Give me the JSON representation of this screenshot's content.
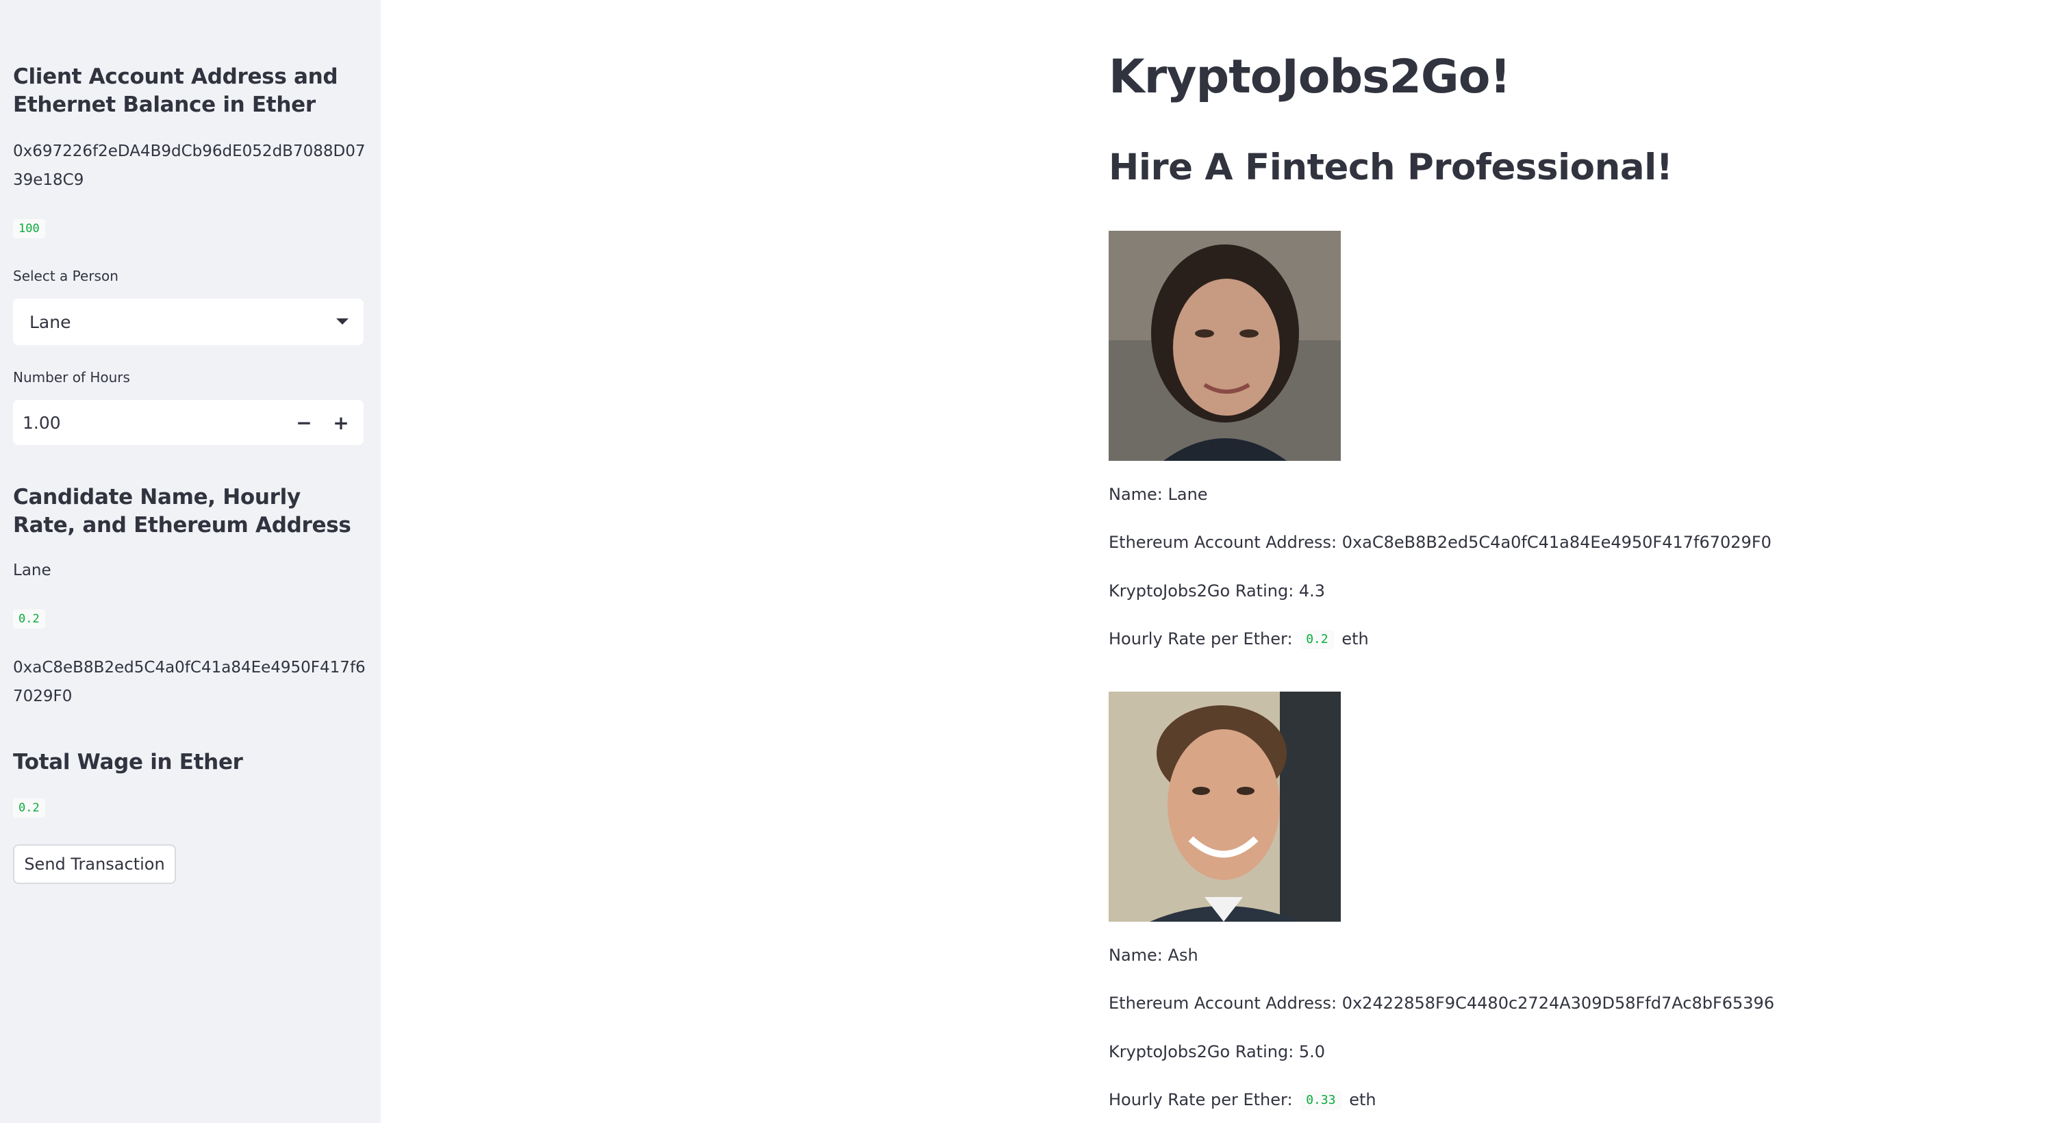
{
  "sidebar": {
    "client_heading": "Client Account Address and Ethernet Balance in Ether",
    "client_address": "0x697226f2eDA4B9dCb96dE052dB7088D0739e18C9",
    "client_balance": "100",
    "select_label": "Select a Person",
    "select_value": "Lane",
    "hours_label": "Number of Hours",
    "hours_value": "1.00",
    "minus_label": "−",
    "plus_label": "+",
    "candidate_heading": "Candidate Name, Hourly Rate, and Ethereum Address",
    "candidate_name": "Lane",
    "candidate_rate": "0.2",
    "candidate_address": "0xaC8eB8B2ed5C4a0fC41a84Ee4950F417f67029F0",
    "wage_heading": "Total Wage in Ether",
    "wage_value": "0.2",
    "send_button": "Send Transaction"
  },
  "main": {
    "title": "KryptoJobs2Go!",
    "subtitle": "Hire A Fintech Professional!",
    "candidates": [
      {
        "name_line": "Name: Lane",
        "address_line": "Ethereum Account Address: 0xaC8eB8B2ed5C4a0fC41a84Ee4950F417f67029F0",
        "rating_line": "KryptoJobs2Go Rating: 4.3",
        "rate_prefix": "Hourly Rate per Ether:",
        "rate_value": "0.2",
        "rate_unit": "eth"
      },
      {
        "name_line": "Name: Ash",
        "address_line": "Ethereum Account Address: 0x2422858F9C4480c2724A309D58Ffd7Ac8bF65396",
        "rating_line": "KryptoJobs2Go Rating: 5.0",
        "rate_prefix": "Hourly Rate per Ether:",
        "rate_value": "0.33",
        "rate_unit": "eth"
      }
    ]
  },
  "colors": {
    "sidebar_bg": "#f0f2f6",
    "text": "#31333f",
    "code_green": "#09ab3b"
  }
}
